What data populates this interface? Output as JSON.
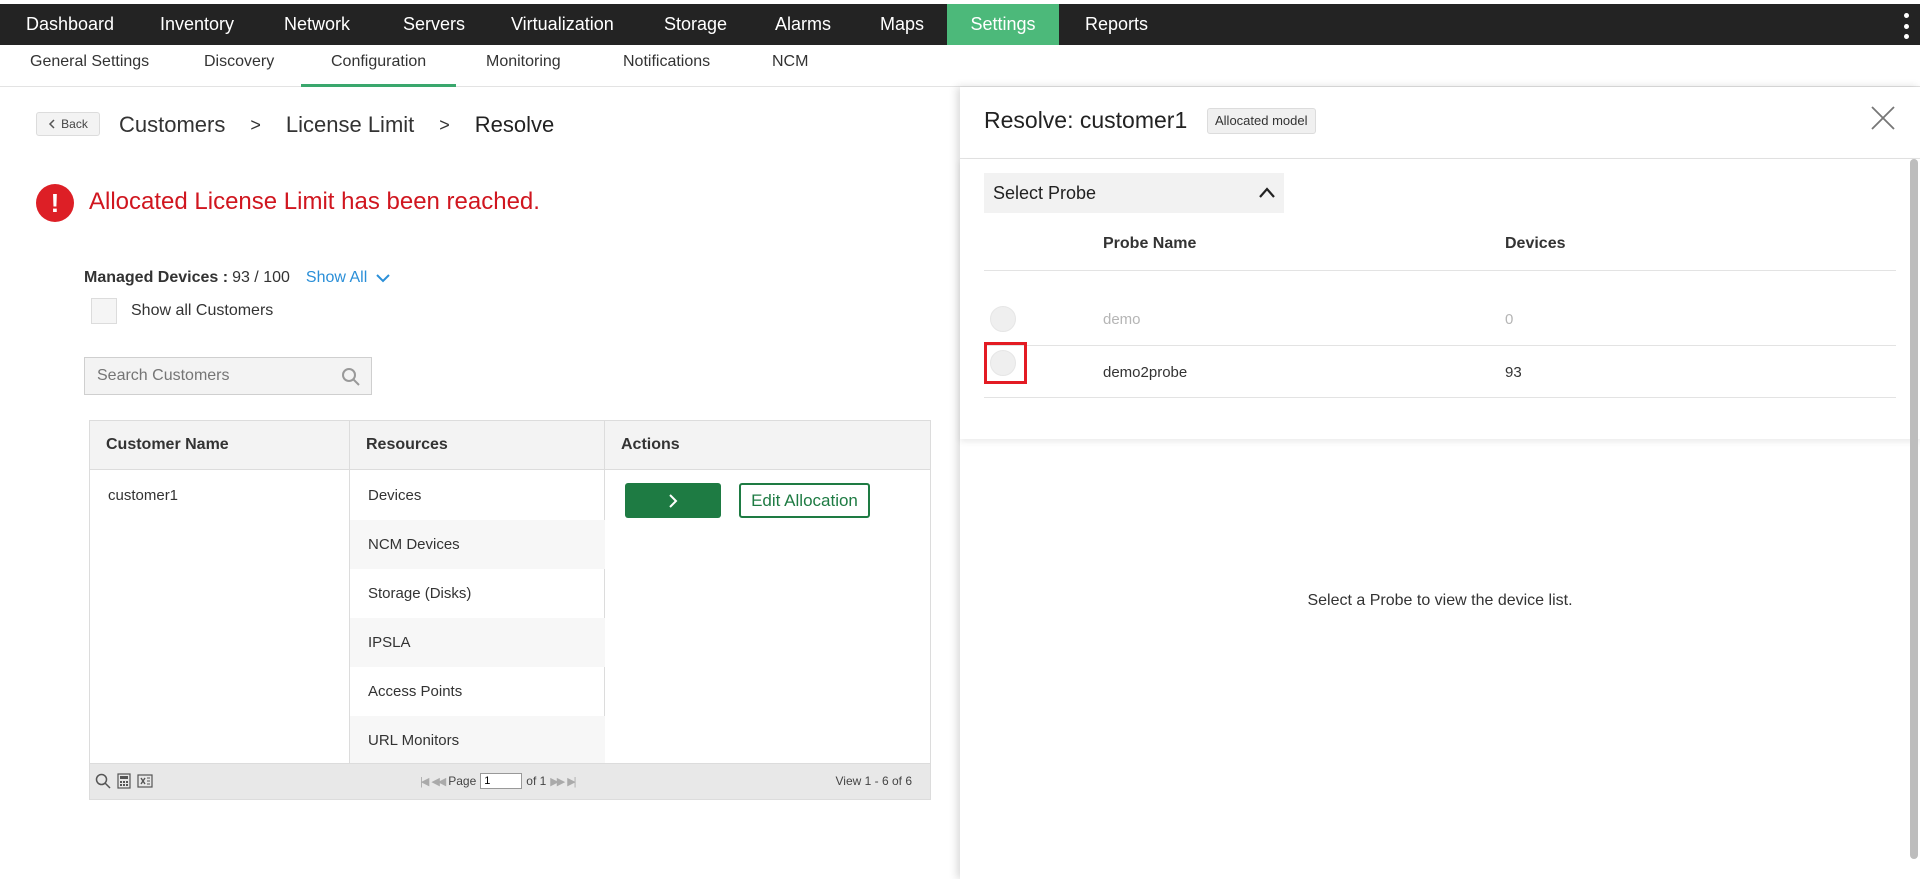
{
  "topnav": {
    "items": [
      "Dashboard",
      "Inventory",
      "Network",
      "Servers",
      "Virtualization",
      "Storage",
      "Alarms",
      "Maps",
      "Settings",
      "Reports"
    ],
    "active": "Settings",
    "accent_color": "#4cb97a"
  },
  "subnav": {
    "items": [
      "General Settings",
      "Discovery",
      "Configuration",
      "Monitoring",
      "Notifications",
      "NCM"
    ],
    "active": "Configuration"
  },
  "breadcrumb": {
    "back_label": "Back",
    "items": [
      "Customers",
      "License Limit",
      "Resolve"
    ],
    "separator": ">"
  },
  "alert": {
    "icon": "exclamation-icon",
    "message": "Allocated License Limit has been reached.",
    "color": "#d0161f"
  },
  "managed": {
    "label": "Managed Devices :",
    "value": "93 / 100",
    "show_all": "Show All"
  },
  "show_all_customers": {
    "label": "Show all Customers",
    "checked": false
  },
  "search": {
    "placeholder": "Search Customers",
    "value": ""
  },
  "table": {
    "headers": [
      "Customer Name",
      "Resources",
      "Actions"
    ],
    "customer": "customer1",
    "resources": [
      "Devices",
      "NCM Devices",
      "Storage (Disks)",
      "IPSLA",
      "Access Points",
      "URL Monitors"
    ],
    "edit_label": "Edit Allocation",
    "pager": {
      "page_label": "Page",
      "page_value": "1",
      "of_label": "of 1",
      "view_info": "View 1 - 6 of 6"
    }
  },
  "panel": {
    "title": "Resolve: customer1",
    "badge": "Allocated model",
    "select_probe": "Select Probe",
    "columns": [
      "Probe Name",
      "Devices"
    ],
    "probes": [
      {
        "name": "demo",
        "devices": "0",
        "disabled": true
      },
      {
        "name": "demo2probe",
        "devices": "93",
        "disabled": false
      }
    ],
    "empty_message": "Select a Probe to view the device list."
  }
}
